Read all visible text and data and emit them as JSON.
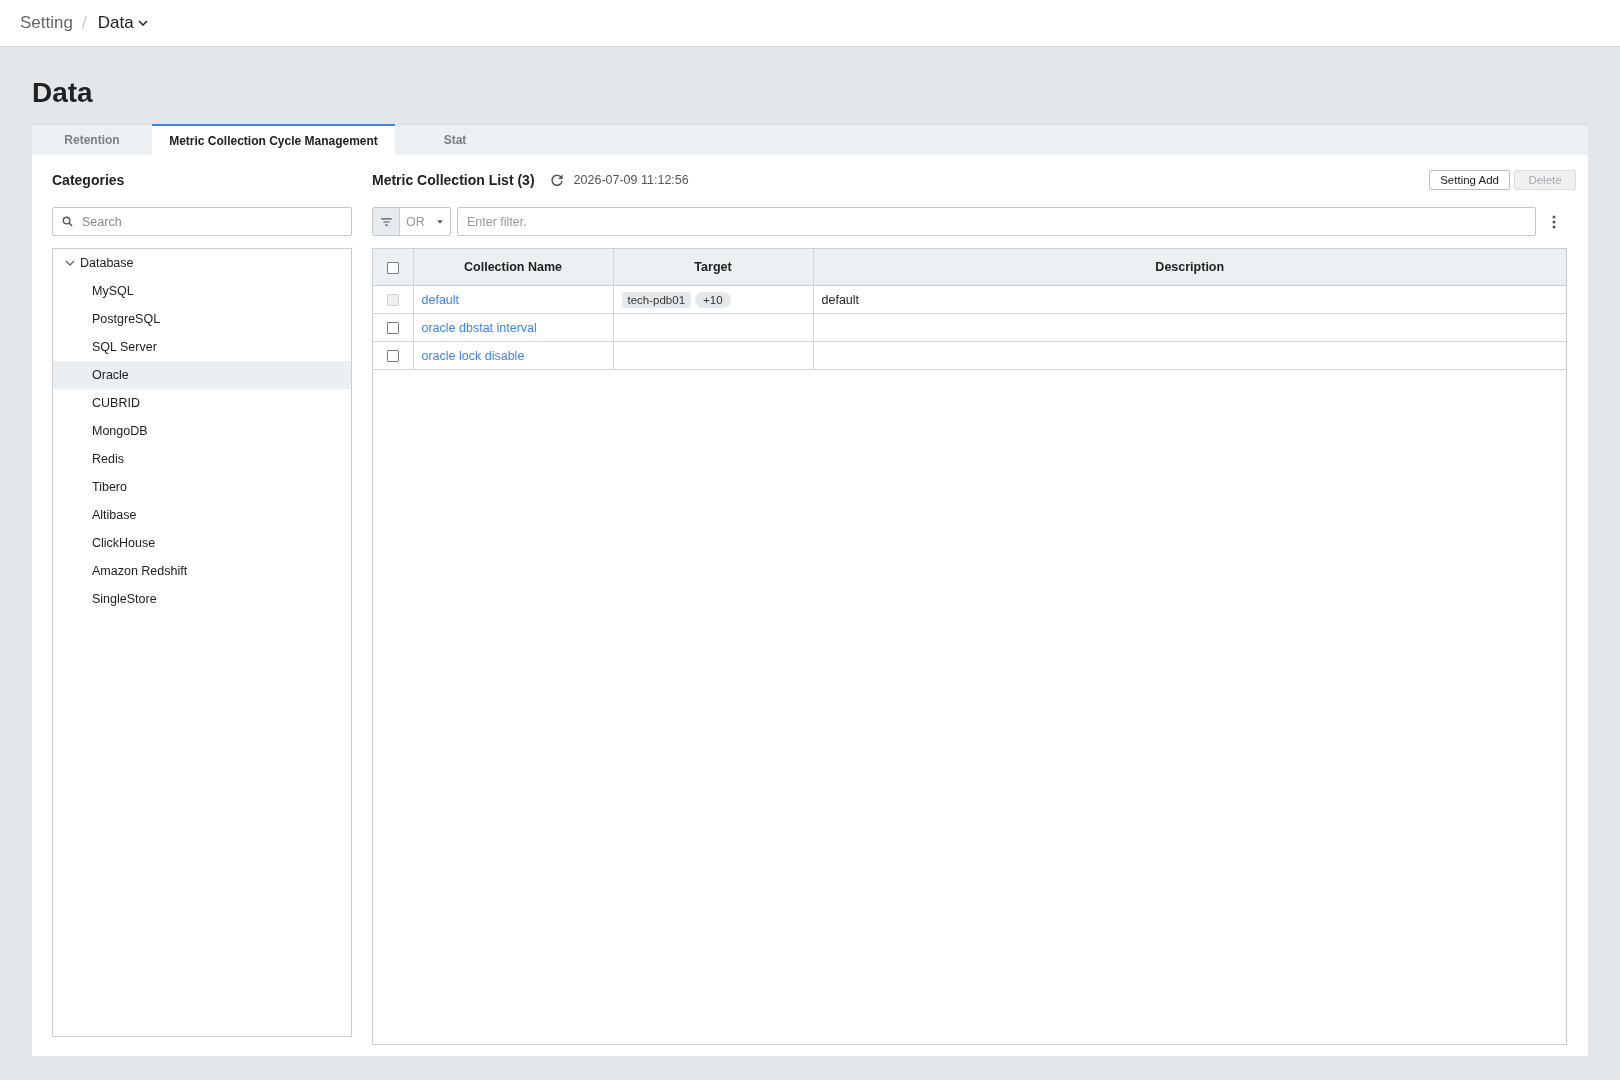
{
  "breadcrumb": {
    "separator": "/",
    "items": [
      {
        "label": "Setting",
        "current": false
      },
      {
        "label": "Data",
        "current": true
      }
    ]
  },
  "page_title": "Data",
  "tabs": [
    {
      "label": "Retention",
      "selected": false
    },
    {
      "label": "Metric Collection Cycle Management",
      "selected": true
    },
    {
      "label": "Stat",
      "selected": false
    }
  ],
  "categories": {
    "title": "Categories",
    "search": {
      "placeholder": "Search"
    },
    "tree": [
      {
        "label": "Database",
        "expanded": true,
        "selected": false,
        "children": [
          {
            "label": "MySQL",
            "selected": false
          },
          {
            "label": "PostgreSQL",
            "selected": false
          },
          {
            "label": "SQL Server",
            "selected": false
          },
          {
            "label": "Oracle",
            "selected": true
          },
          {
            "label": "CUBRID",
            "selected": false
          },
          {
            "label": "MongoDB",
            "selected": false
          },
          {
            "label": "Redis",
            "selected": false
          },
          {
            "label": "Tibero",
            "selected": false
          },
          {
            "label": "Altibase",
            "selected": false
          },
          {
            "label": "ClickHouse",
            "selected": false
          },
          {
            "label": "Amazon Redshift",
            "selected": false
          },
          {
            "label": "SingleStore",
            "selected": false
          }
        ]
      }
    ]
  },
  "collection_list": {
    "title": "Metric Collection List (3)",
    "updated_at": "2026-07-09 11:12:56",
    "buttons": [
      {
        "label": "Setting Add",
        "disabled": false
      },
      {
        "label": "Delete",
        "disabled": true
      }
    ],
    "filter": {
      "operator": "OR",
      "placeholder": "Enter filter."
    },
    "table": {
      "select_all": {
        "checked": false
      },
      "columns": [
        "Collection Name",
        "Target",
        "Description"
      ],
      "rows": [
        {
          "checked": false,
          "disabled": true,
          "name": "default",
          "targets": [
            {
              "kind": "tag",
              "label": "tech-pdb01"
            },
            {
              "kind": "count",
              "label": "+10"
            }
          ],
          "description": "default"
        },
        {
          "checked": false,
          "disabled": false,
          "name": "oracle dbstat interval"
        },
        {
          "checked": false,
          "disabled": false,
          "name": "oracle lock disable"
        }
      ]
    }
  }
}
